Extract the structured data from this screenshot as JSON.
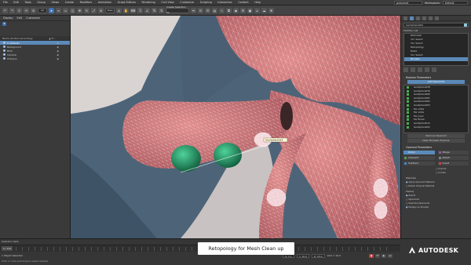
{
  "menu": [
    "File",
    "Edit",
    "Tools",
    "Group",
    "Views",
    "Create",
    "Modifiers",
    "Animation",
    "Graph Editors",
    "Rendering",
    "Civil View",
    "Customize",
    "Scripting",
    "Interactive",
    "Content",
    "Help"
  ],
  "workspace": {
    "user": "guroumat",
    "label": "Workspaces:",
    "value": "Default"
  },
  "toolbar": {
    "filter": "All",
    "selection_set": "Create Selection Se"
  },
  "scene_explorer": {
    "tabs": [
      "Display",
      "Edit",
      "Customize"
    ],
    "header_name": "Name (Sorted Ascending)",
    "header_frozen": "▲ Fr...",
    "rows": [
      {
        "name": "0 (default)",
        "selected": true
      },
      {
        "name": "Background",
        "selected": false
      },
      {
        "name": "Blob",
        "selected": false
      },
      {
        "name": "Camera",
        "selected": false
      },
      {
        "name": "Octopus",
        "selected": false
      }
    ]
  },
  "viewport": {
    "label": "[+] [PhysCamera001] [User Defined] [Default Shading]",
    "tooltip": "GeoSphere033",
    "colors": {
      "background": "#4d6478",
      "mesh": "#c97575",
      "wire": "#ffffff",
      "green": "#1f8a5a",
      "bg_shape": "#d9d3d2"
    }
  },
  "command_panel": {
    "object_name": "GeoSphere001",
    "modifier_list_label": "Modifier List",
    "modifiers": [
      {
        "label": "Retimesh",
        "selected": false
      },
      {
        "label": "Vol. Select",
        "selected": false
      },
      {
        "label": "Vol. Select",
        "selected": false
      },
      {
        "label": "Retopology",
        "selected": false
      },
      {
        "label": "Relax",
        "selected": false
      },
      {
        "label": "Vol. Select",
        "selected": false
      },
      {
        "label": "Boolean",
        "selected": true
      }
    ],
    "boolean_params_title": "Boolean Parameters",
    "add_operands": "Add Operands",
    "operands": [
      "GeoSphere038",
      "GeoSphere039",
      "GeoSphere060",
      "GeoSphere061",
      "GeoSphere062",
      "GeoSphere063",
      "Ear white",
      "Ear white",
      "Ear pupil",
      "Ear Brown",
      "GeoSphere012",
      "GeoSphere002"
    ],
    "remove_operand": "Remove Operand",
    "open_explorer": "Open Boolean Explorer",
    "operand_params_title": "Operand Parameters",
    "ops": [
      {
        "label": "Union",
        "active": true,
        "color": "#3d8ee0"
      },
      {
        "label": "Merge",
        "active": false,
        "color": "#9b59b6"
      },
      {
        "label": "Intersect",
        "active": false,
        "color": "#4caf50"
      },
      {
        "label": "Attach",
        "active": false,
        "color": "#7f8c8d"
      },
      {
        "label": "Subtract",
        "active": false,
        "color": "#3d8ee0"
      },
      {
        "label": "Insert",
        "active": false,
        "color": "#e0443d"
      }
    ],
    "imprint": "Imprint",
    "cookie": "Cookie",
    "materials_title": "Materials",
    "material_options": [
      {
        "label": "Apply Operand Material",
        "on": true
      },
      {
        "label": "Retain Original Material",
        "on": false
      }
    ],
    "display_title": "Display",
    "display_options": [
      {
        "label": "Result",
        "on": true
      },
      {
        "label": "Operands",
        "on": false
      },
      {
        "label": "Selected Operands",
        "on": false
      },
      {
        "label": "Display as Shaded",
        "on": true
      }
    ]
  },
  "bottom": {
    "selection_sets": "Selection Sets:",
    "time_slider": "0 / 100",
    "status": "1 Object Selected",
    "prompt": "Click or click-and-drag to select objects",
    "x": "X: 1.1",
    "y": "Y: 10.0",
    "z": "Z: 20.0",
    "grid": "Grid = 10.0",
    "add_time_tag": "Add Time Tag"
  },
  "caption": "Retopology for Mesh Clean up",
  "brand": "AUTODESK"
}
